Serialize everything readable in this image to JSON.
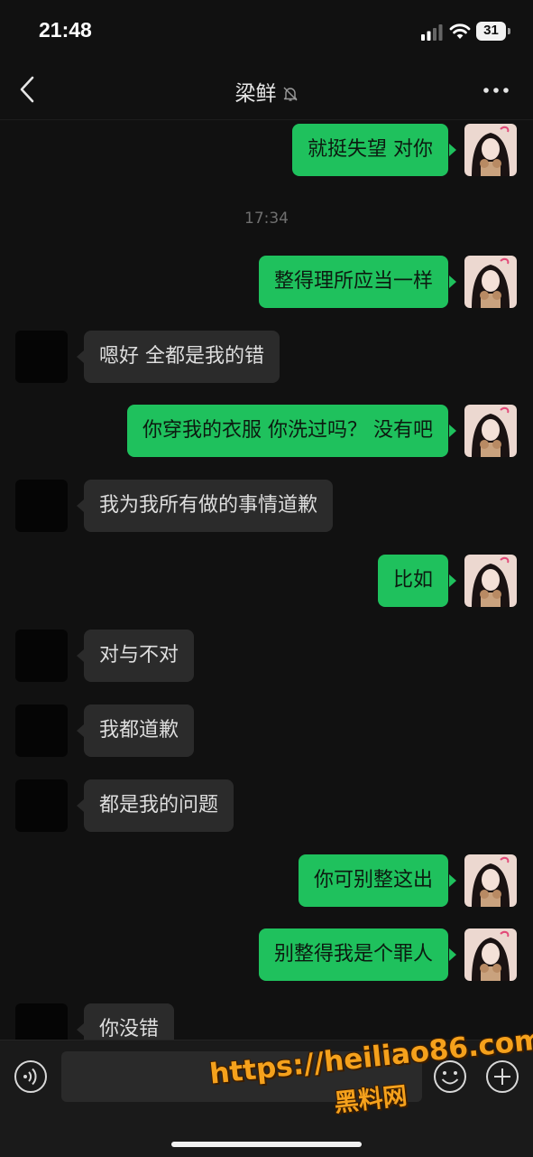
{
  "status_bar": {
    "time": "21:48",
    "battery": "31"
  },
  "header": {
    "title": "梁鲜",
    "muted": true,
    "icons": [
      "back-chevron-icon",
      "bell-off-icon",
      "more-dots-icon"
    ]
  },
  "messages": [
    {
      "dir": "out",
      "text": "就挺失望 对你"
    },
    {
      "type": "timestamp",
      "text": "17:34"
    },
    {
      "dir": "out",
      "text": "整得理所应当一样"
    },
    {
      "dir": "in",
      "text": "嗯好 全都是我的错"
    },
    {
      "dir": "out",
      "text": "你穿我的衣服 你洗过吗？ 没有吧"
    },
    {
      "dir": "in",
      "text": "我为我所有做的事情道歉"
    },
    {
      "dir": "out",
      "text": "比如"
    },
    {
      "dir": "in",
      "text": "对与不对"
    },
    {
      "dir": "in",
      "text": "我都道歉"
    },
    {
      "dir": "in",
      "text": "都是我的问题"
    },
    {
      "dir": "out",
      "text": "你可别整这出"
    },
    {
      "dir": "out",
      "text": "别整得我是个罪人"
    },
    {
      "dir": "in",
      "text": "你没错"
    }
  ],
  "input_bar": {
    "value": "",
    "icons": [
      "voice-icon",
      "emoji-icon",
      "plus-icon"
    ]
  },
  "watermark": {
    "url": "https://heiliao86.com",
    "name": "黑料网"
  },
  "colors": {
    "background": "#111111",
    "outgoing_bubble": "#1fc15d",
    "incoming_bubble": "#2b2b2b",
    "timestamp": "#6f6f6f"
  }
}
